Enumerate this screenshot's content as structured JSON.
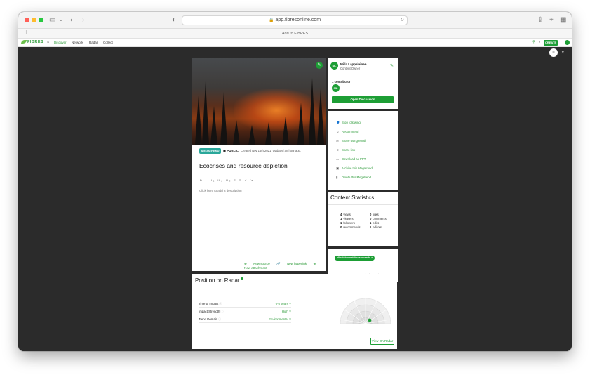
{
  "browser": {
    "url": "app.fibresonline.com",
    "page_title": "Add to FIBRES"
  },
  "app_nav": {
    "logo": "FIBRES",
    "items": [
      "Discover",
      "Network",
      "Radar",
      "Collect"
    ],
    "create_label": "CREATE"
  },
  "overlay": {
    "badge": "0",
    "close": "×"
  },
  "main": {
    "tag": "MEGATREND",
    "visibility": "PUBLIC",
    "created": "Created Nov 16th 2021. Updated an hour ago.",
    "title": "Ecocrises and resource depletion",
    "format_tools": "B I H₁ H₂ H₃ ≡ ≡ ↗ ↘",
    "description_placeholder": "Click here to add a description",
    "add_links": [
      "New source",
      "New hyperlink",
      "New attachment"
    ]
  },
  "owner": {
    "initials": "ML",
    "name": "Milla Lappalainen",
    "role": "Content Owner",
    "contributors": "1 contributor",
    "open_discussion": "Open Discussion"
  },
  "actions": [
    {
      "icon": "user-icon",
      "label": "Stop following"
    },
    {
      "icon": "recommend-icon",
      "label": "Recommend"
    },
    {
      "icon": "email-icon",
      "label": "Share using email"
    },
    {
      "icon": "share-icon",
      "label": "Share link"
    },
    {
      "icon": "download-icon",
      "label": "Download as PPT"
    },
    {
      "icon": "archive-icon",
      "label": "Archive this Megatrend"
    },
    {
      "icon": "trash-icon",
      "label": "Delete this Megatrend"
    }
  ],
  "stats": {
    "title": "Content Statistics",
    "left": [
      {
        "n": "4",
        "label": "views"
      },
      {
        "n": "1",
        "label": "viewers"
      },
      {
        "n": "1",
        "label": "followers"
      },
      {
        "n": "0",
        "label": "recommends"
      }
    ],
    "right": [
      {
        "n": "0",
        "label": "links"
      },
      {
        "n": "0",
        "label": "comments"
      },
      {
        "n": "1",
        "label": "edits"
      },
      {
        "n": "1",
        "label": "editors"
      }
    ]
  },
  "tags": {
    "chip": "elinolohuonet/ilmastotrends ×",
    "input_placeholder": "Add a new tag"
  },
  "radar": {
    "title": "Position on Radar",
    "rows": [
      {
        "label": "Time to Impact",
        "value": "0-5 years ∨"
      },
      {
        "label": "Impact Strength",
        "value": "High ∨"
      },
      {
        "label": "Trend Domain",
        "value": "Environmental ∨"
      }
    ],
    "view_button": "View On Radar"
  },
  "colors": {
    "brand_green": "#1d9e35",
    "tag_teal": "#2aa79a"
  }
}
